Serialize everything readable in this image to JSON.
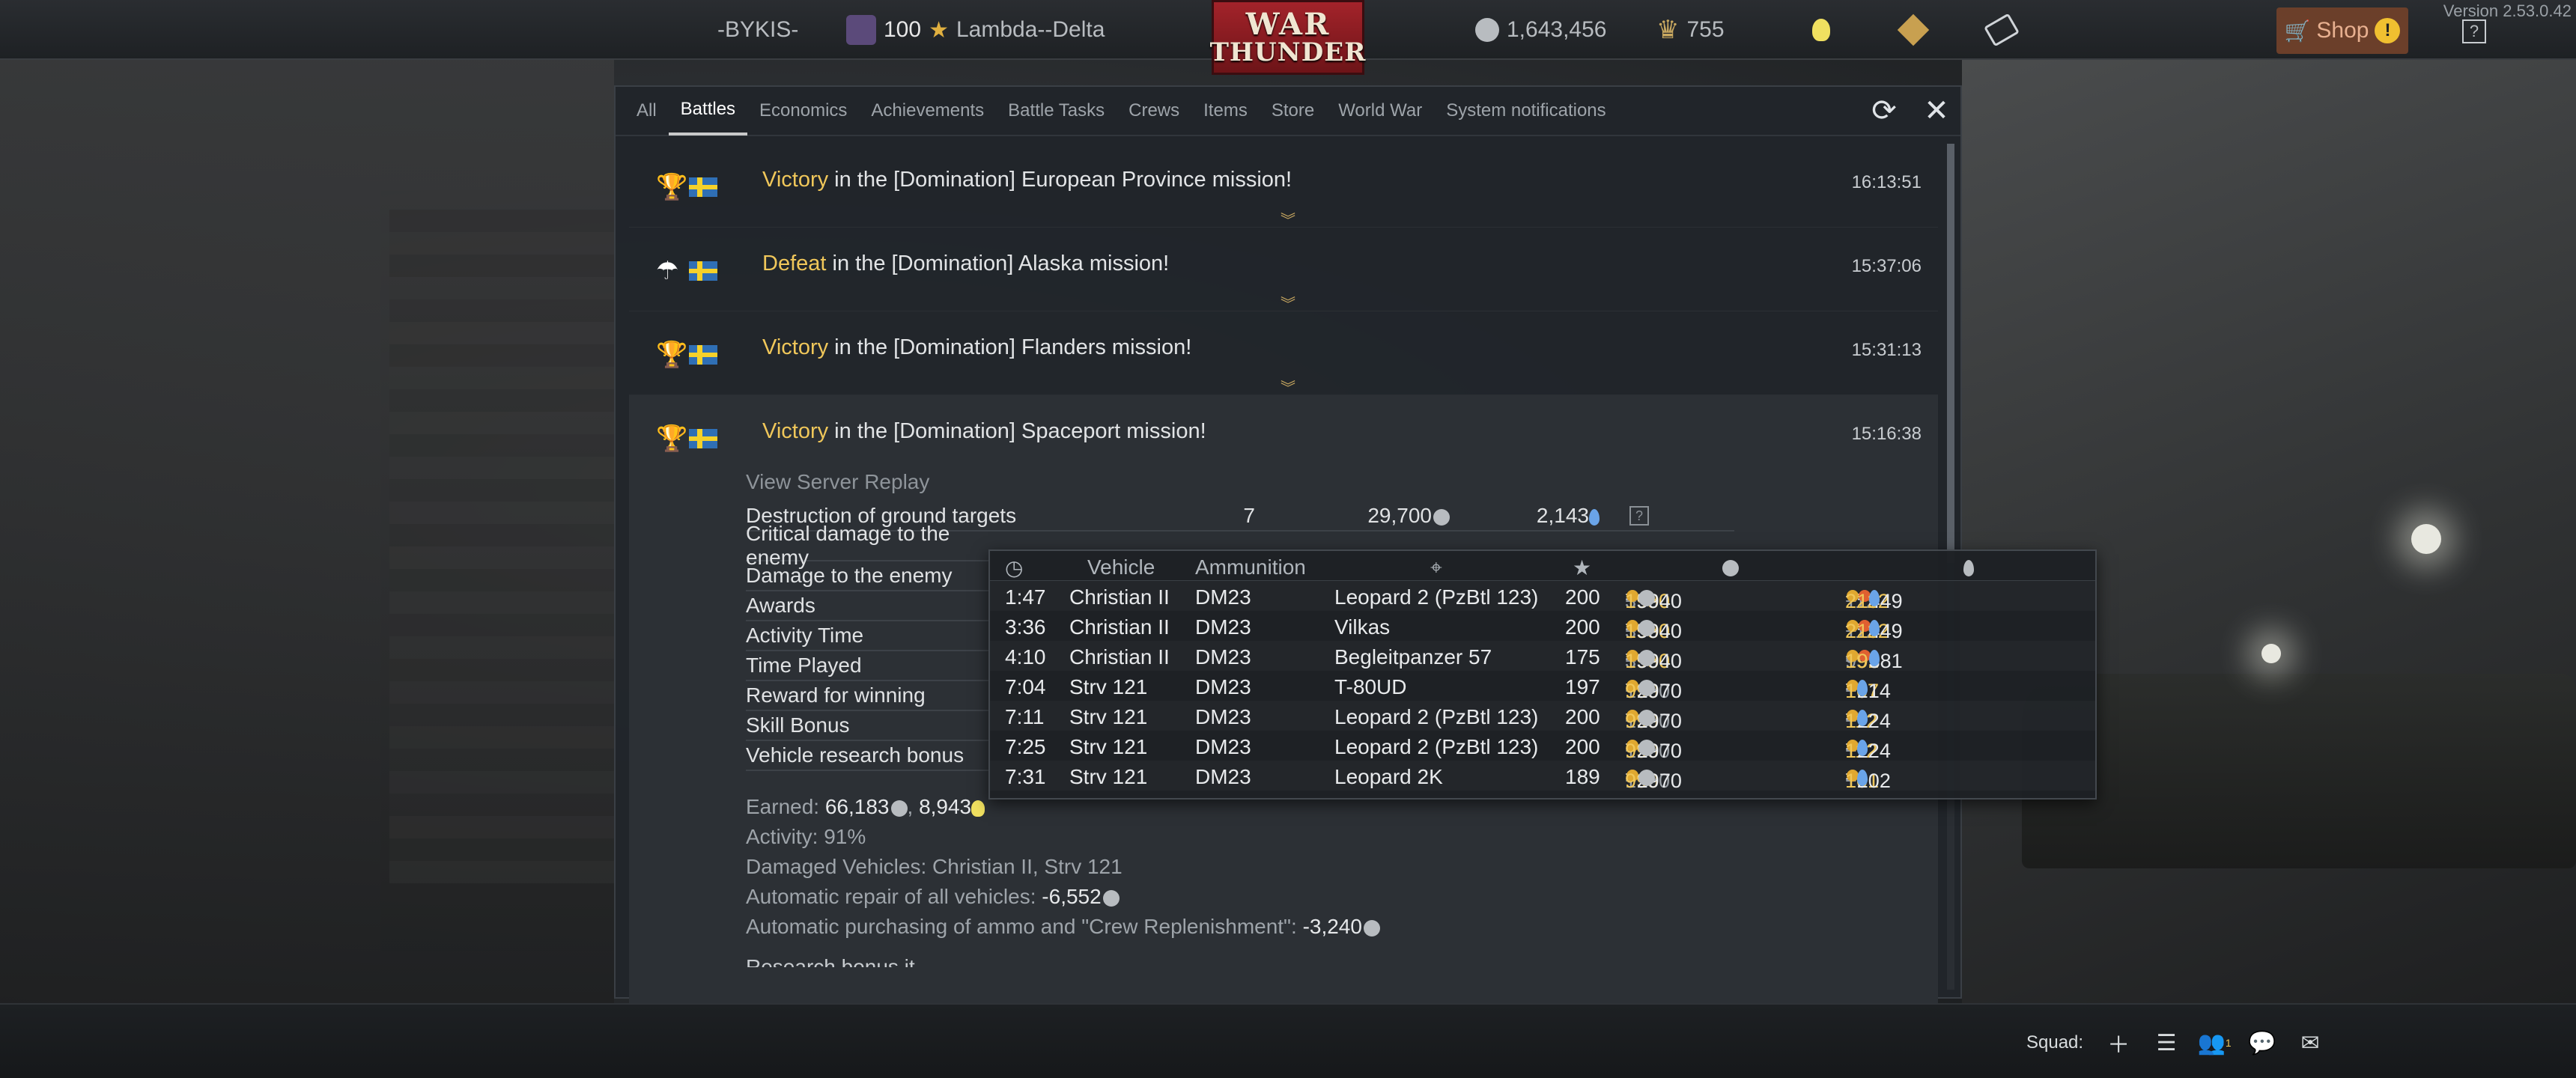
{
  "topbar": {
    "player_name": "-BYKIS-",
    "level": "100",
    "title": "Lambda--Delta",
    "logo_line1": "WAR",
    "logo_line2": "THUNDER",
    "silver_lions": "1,643,456",
    "golden_eagles": "755",
    "shop_label": "Shop",
    "version": "Version 2.53.0.42"
  },
  "tabs": [
    "All",
    "Battles",
    "Economics",
    "Achievements",
    "Battle Tasks",
    "Crews",
    "Items",
    "Store",
    "World War",
    "System notifications"
  ],
  "active_tab": "Battles",
  "messages": [
    {
      "result": "Victory",
      "text": " in the [Domination] European Province mission!",
      "time": "16:13:51"
    },
    {
      "result": "Defeat",
      "text": " in the [Domination] Alaska mission!",
      "time": "15:37:06"
    },
    {
      "result": "Victory",
      "text": " in the [Domination] Flanders mission!",
      "time": "15:31:13"
    }
  ],
  "expanded": {
    "result": "Victory",
    "text": " in the [Domination] Spaceport mission!",
    "time": "15:16:38",
    "replay_label": "View Server Replay",
    "reward_rows": [
      {
        "label": "Destruction of ground targets",
        "count": "7",
        "sl": "29,700",
        "rp": "2,143"
      },
      {
        "label": "Critical damage to the enemy"
      },
      {
        "label": "Damage to the enemy"
      },
      {
        "label": "Awards"
      },
      {
        "label": "Activity Time"
      },
      {
        "label": "Time Played"
      },
      {
        "label": "Reward for winning"
      },
      {
        "label": "Skill Bonus"
      },
      {
        "label": "Vehicle research bonus"
      }
    ],
    "earned_label": "Earned:",
    "earned_sl": "66,183",
    "earned_rp": "8,943",
    "activity": "Activity: 91%",
    "damaged_vehicles": "Damaged Vehicles: Christian II, Strv 121",
    "repair_label": "Automatic repair of all vehicles:",
    "repair_value": "-6,552",
    "ammo_label": "Automatic purchasing of ammo and \"Crew Replenishment\":",
    "ammo_value": "-3,240",
    "cut_text": "Research bonus it..."
  },
  "tooltip": {
    "headers": {
      "vehicle": "Vehicle",
      "ammo": "Ammunition"
    },
    "rows": [
      {
        "time": "1:47",
        "vehicle": "Christian II",
        "ammo": "DM23",
        "target": "Leopard 2 (PzBtl 123)",
        "score": "200",
        "sl_a": "3960",
        "sl_b": "1980",
        "sl_total": "5940",
        "rp_a": "112",
        "rp_b": "225",
        "rp_c": "112",
        "rp_total": "449"
      },
      {
        "time": "3:36",
        "vehicle": "Christian II",
        "ammo": "DM23",
        "target": "Vilkas",
        "score": "200",
        "sl_a": "3960",
        "sl_b": "1980",
        "sl_total": "5940",
        "rp_a": "112",
        "rp_b": "225",
        "rp_c": "112",
        "rp_total": "449"
      },
      {
        "time": "4:10",
        "vehicle": "Christian II",
        "ammo": "DM23",
        "target": "Begleitpanzer 57",
        "score": "175",
        "sl_a": "3960",
        "sl_b": "1980",
        "sl_total": "5940",
        "rp_a": "95",
        "rp_b": "191",
        "rp_c": "95",
        "rp_total": "381"
      },
      {
        "time": "7:04",
        "vehicle": "Strv 121",
        "ammo": "DM23",
        "target": "T-80UD",
        "score": "197",
        "sl_a": "1980",
        "sl_b": "990",
        "sl_total": "2970",
        "rp_a": "107",
        "rp_b": "107",
        "rp_c": "",
        "rp_total": "214"
      },
      {
        "time": "7:11",
        "vehicle": "Strv 121",
        "ammo": "DM23",
        "target": "Leopard 2 (PzBtl 123)",
        "score": "200",
        "sl_a": "1980",
        "sl_b": "990",
        "sl_total": "2970",
        "rp_a": "112",
        "rp_b": "112",
        "rp_c": "",
        "rp_total": "224"
      },
      {
        "time": "7:25",
        "vehicle": "Strv 121",
        "ammo": "DM23",
        "target": "Leopard 2 (PzBtl 123)",
        "score": "200",
        "sl_a": "1980",
        "sl_b": "990",
        "sl_total": "2970",
        "rp_a": "112",
        "rp_b": "112",
        "rp_c": "",
        "rp_total": "224"
      },
      {
        "time": "7:31",
        "vehicle": "Strv 121",
        "ammo": "DM23",
        "target": "Leopard 2K",
        "score": "189",
        "sl_a": "1980",
        "sl_b": "990",
        "sl_total": "2970",
        "rp_a": "101",
        "rp_b": "101",
        "rp_c": "",
        "rp_total": "202"
      }
    ]
  },
  "bottombar": {
    "squad_label": "Squad:",
    "friends_count": "1"
  },
  "colors": {
    "accent_gold": "#f0c75a",
    "rp_blue": "#6aa4e8",
    "panel_bg": "#21252a"
  }
}
